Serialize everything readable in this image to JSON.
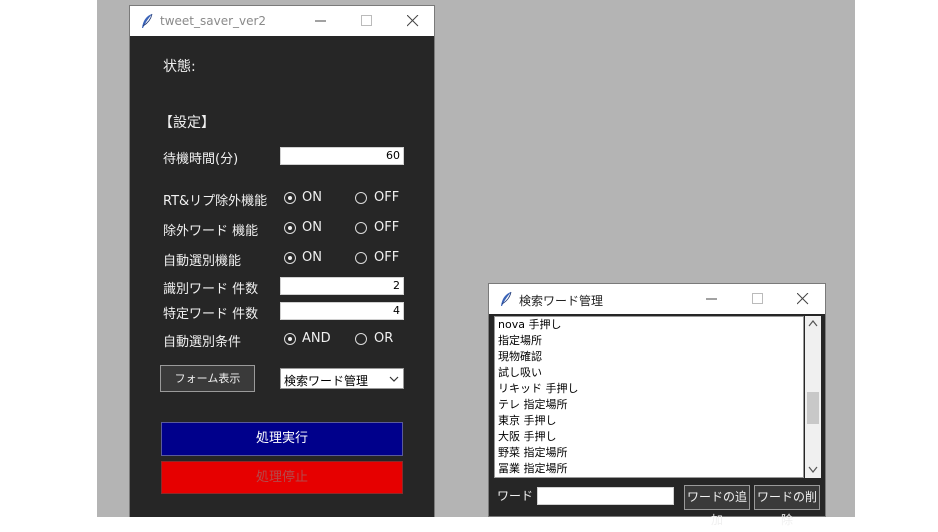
{
  "main_window": {
    "title": "tweet_saver_ver2",
    "status_label": "状態:",
    "settings_header": "【設定】",
    "wait_time": {
      "label": "待機時間(分)",
      "value": "60"
    },
    "rt_reply_exclude": {
      "label": "RT&リプ除外機能",
      "on": "ON",
      "off": "OFF",
      "selected": "ON"
    },
    "exclude_word": {
      "label": "除外ワード 機能",
      "on": "ON",
      "off": "OFF",
      "selected": "ON"
    },
    "auto_select": {
      "label": "自動選別機能",
      "on": "ON",
      "off": "OFF",
      "selected": "ON"
    },
    "identify_word_count": {
      "label": "識別ワード 件数",
      "value": "2"
    },
    "specific_word_count": {
      "label": "特定ワード 件数",
      "value": "4"
    },
    "auto_select_condition": {
      "label": "自動選別条件",
      "and": "AND",
      "or": "OR",
      "selected": "AND"
    },
    "form_display_button": "フォーム表示",
    "form_select": {
      "value": "検索ワード管理"
    },
    "run_button": "処理実行",
    "stop_button": "処理停止"
  },
  "sub_window": {
    "title": "検索ワード管理",
    "list_items": [
      "nova 手押し",
      "指定場所",
      "現物確認",
      "試し吸い",
      "リキッド 手押し",
      "テレ 指定場所",
      "東京 手押し",
      "大阪 手押し",
      "野菜 指定場所",
      "冨業 指定場所"
    ],
    "word_label": "ワード",
    "word_input": "",
    "add_button": "ワードの追加",
    "delete_button": "ワードの削除"
  },
  "colors": {
    "desktop": "#b4b4b4",
    "window_bg": "#262626",
    "run_button": "#00008b",
    "stop_button": "#e60000"
  }
}
